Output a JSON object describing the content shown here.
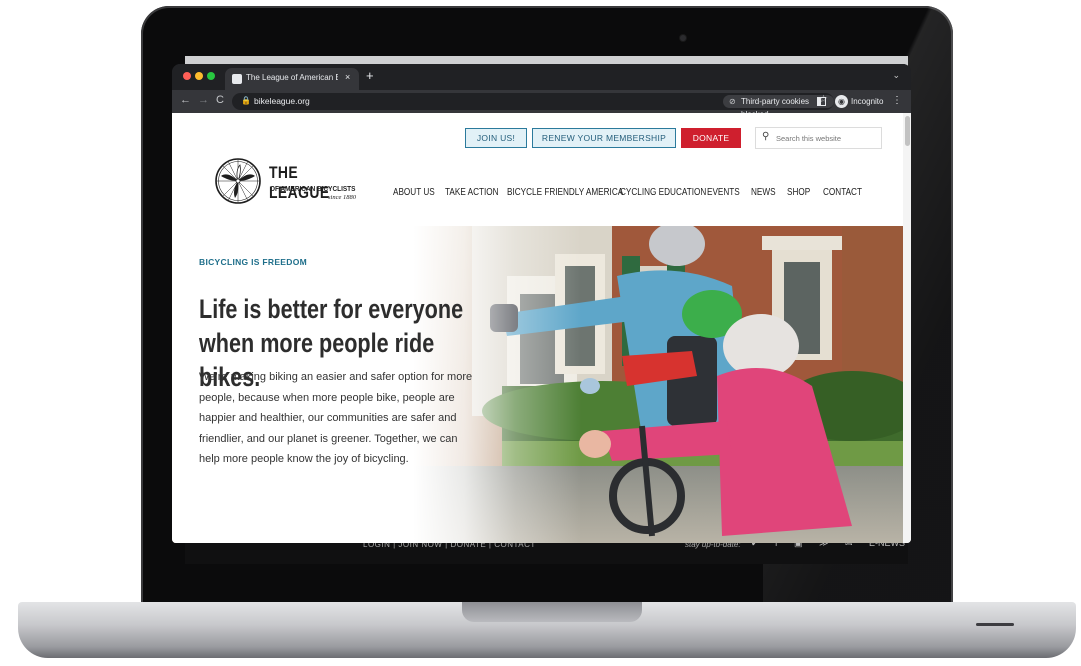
{
  "browser": {
    "tab_title": "The League of American Bicyc",
    "tab_close": "×",
    "new_tab": "+",
    "url": "bikeleague.org",
    "cookies_chip": "Third-party cookies blocked",
    "profile_label": "Incognito",
    "nav": {
      "back": "←",
      "forward": "→",
      "reload": "C"
    },
    "menu_glyph": "⋮",
    "tab_menu_glyph": "⌄"
  },
  "background_page": {
    "footer_links": "LOGIN | JOIN NOW | DONATE | CONTACT",
    "stay_up_to_date": "stay up-to-date:",
    "social_glyphs": "✔ f ▣ ≫ ✉",
    "enews": "E-NEWS"
  },
  "site": {
    "utility": {
      "join_label": "JOIN US!",
      "renew_label": "RENEW YOUR MEMBERSHIP",
      "donate_label": "DONATE",
      "search_placeholder": "Search this website"
    },
    "logo": {
      "line1": "THE LEAGUE",
      "line2": "OF AMERICAN BICYCLISTS",
      "line3": "since 1880"
    },
    "nav": [
      {
        "label": "ABOUT US"
      },
      {
        "label": "TAKE ACTION"
      },
      {
        "label": "BICYCLE FRIENDLY AMERICA"
      },
      {
        "label": "CYCLING EDUCATION"
      },
      {
        "label": "EVENTS"
      },
      {
        "label": "NEWS"
      },
      {
        "label": "SHOP"
      },
      {
        "label": "CONTACT"
      }
    ],
    "hero": {
      "eyebrow": "BICYCLING IS FREEDOM",
      "headline": "Life is better for everyone when more people ride bikes.",
      "body": "We’re making biking an easier and safer option for more people, because when more people bike, people are happier and healthier, our communities are safer and friendlier, and our planet is greener. Together, we can help more people know the joy of bicycling."
    }
  },
  "colors": {
    "accent_teal": "#1f6f8b",
    "donate_red": "#cf1f2e",
    "chrome_dark": "#202124",
    "chrome_toolbar": "#35363a"
  }
}
